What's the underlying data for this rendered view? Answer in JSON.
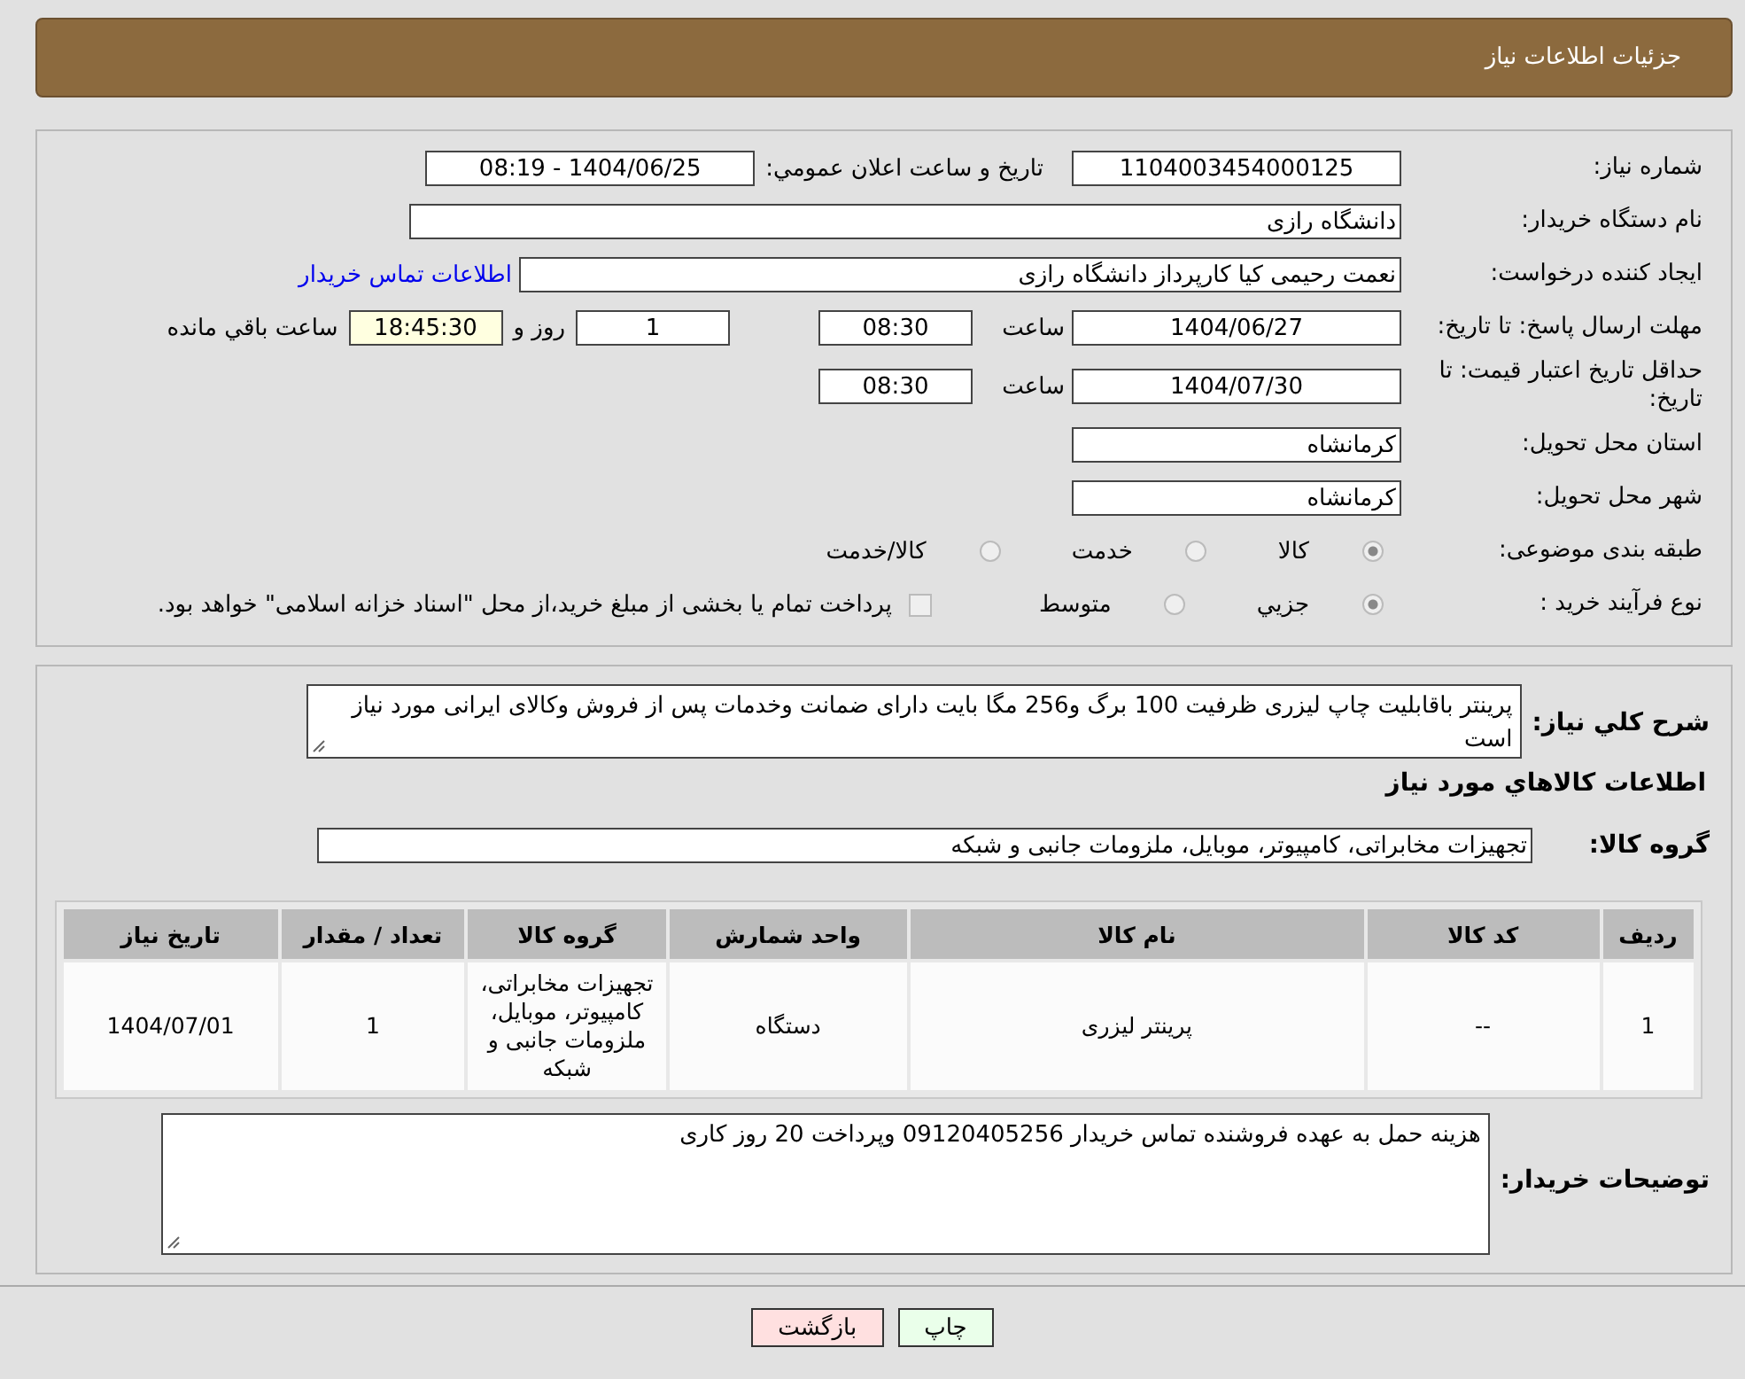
{
  "header": {
    "title": "جزئیات اطلاعات نیاز"
  },
  "need_number": {
    "label": "شماره نیاز:",
    "value": "1104003454000125"
  },
  "announce": {
    "label": "تاریخ و ساعت اعلان عمومي:",
    "value": "1404/06/25 - 08:19"
  },
  "buyer_org": {
    "label": "نام دستگاه خریدار:",
    "value": "دانشگاه رازی"
  },
  "requester": {
    "label": "ایجاد کننده درخواست:",
    "value": "نعمت رحیمی کیا کارپرداز دانشگاه رازی",
    "link": "اطلاعات تماس خریدار"
  },
  "reply_deadline": {
    "label": "مهلت ارسال پاسخ: تا تاریخ:",
    "date": "1404/06/27",
    "time_label": "ساعت",
    "time": "08:30",
    "days": "1",
    "days_label": "روز و",
    "remaining": "18:45:30",
    "remaining_label": "ساعت باقي مانده"
  },
  "price_validity": {
    "label": "حداقل تاریخ اعتبار قیمت: تا تاریخ:",
    "date": "1404/07/30",
    "time_label": "ساعت",
    "time": "08:30"
  },
  "province": {
    "label": "استان محل تحویل:",
    "value": "كرمانشاه"
  },
  "city": {
    "label": "شهر محل تحویل:",
    "value": "كرمانشاه"
  },
  "category": {
    "label": "طبقه بندی موضوعی:",
    "options": [
      {
        "label": "كالا",
        "selected": true
      },
      {
        "label": "خدمت",
        "selected": false
      },
      {
        "label": "كالا/خدمت",
        "selected": false
      }
    ]
  },
  "purchase_type": {
    "label": "نوع فرآیند خرید :",
    "options": [
      {
        "kind": "radio",
        "label": "جزيي",
        "selected": true
      },
      {
        "kind": "radio",
        "label": "متوسط",
        "selected": false
      },
      {
        "kind": "checkbox",
        "label": "پرداخت تمام یا بخشی از مبلغ خرید،از محل \"اسناد خزانه اسلامی\" خواهد بود.",
        "checked": false
      }
    ]
  },
  "description": {
    "label": "شرح كلي نياز:",
    "value": "پرینتر باقابلیت چاپ لیزری ظرفیت 100 برگ و256 مگا بایت دارای ضمانت وخدمات پس از فروش وكالای ایرانی مورد نیاز است"
  },
  "goods_title": "اطلاعات كالاهاي مورد نياز",
  "goods_group": {
    "label": "گروه كالا:",
    "value": "تجهیزات مخابراتی، کامپیوتر، موبایل، ملزومات جانبی و شبکه"
  },
  "table": {
    "columns": [
      "رديف",
      "كد كالا",
      "نام كالا",
      "واحد شمارش",
      "گروه كالا",
      "تعداد / مقدار",
      "تاريخ نياز"
    ],
    "rows": [
      [
        "1",
        "--",
        "پرینتر لیزری",
        "دستگاه",
        "تجهیزات مخابراتی، کامپیوتر، موبایل، ملزومات جانبی و شبکه",
        "1",
        "1404/07/01"
      ]
    ]
  },
  "buyer_notes": {
    "label": "توضیحات خریدار:",
    "value": "هزینه حمل به عهده فروشنده تماس خریدار 09120405256 وپرداخت 20 روز کاری"
  },
  "buttons": [
    {
      "kind": "print",
      "label": "چاپ"
    },
    {
      "kind": "back",
      "label": "بازگشت"
    }
  ]
}
